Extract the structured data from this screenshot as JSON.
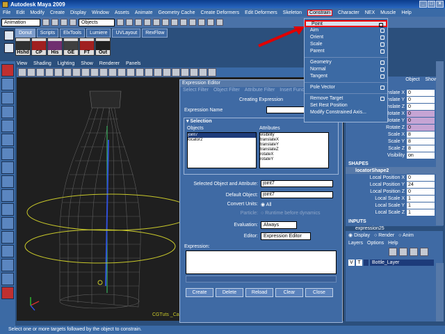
{
  "window": {
    "title": "Autodesk Maya 2009",
    "controls": [
      "_",
      "□",
      "×"
    ]
  },
  "menubar": [
    "File",
    "Edit",
    "Modify",
    "Create",
    "Display",
    "Window",
    "Assets",
    "Animate",
    "Geometry Cache",
    "Create Deformers",
    "Edit Deformers",
    "Skeleton",
    "Constrain",
    "Character",
    "NEX",
    "Muscle",
    "Help"
  ],
  "active_menu": "Constrain",
  "statusline": {
    "mode": "Animation",
    "selection_mode": "Objects"
  },
  "shelf": {
    "tabs": [
      "Donut",
      "Scripts",
      "ElxTools",
      "Lumiere",
      "UVLayout",
      "RexFlow"
    ],
    "buttons": [
      "Hshd",
      "CP",
      "His",
      "GE",
      "FT",
      "Out"
    ]
  },
  "viewport": {
    "menu": [
      "View",
      "Shading",
      "Lighting",
      "Show",
      "Renderer",
      "Panels"
    ],
    "camera_label": "CGTuts _Camera"
  },
  "constrain_menu": {
    "group1": [
      "Point",
      "Aim",
      "Orient",
      "Scale",
      "Parent"
    ],
    "group2": [
      "Geometry",
      "Normal",
      "Tangent"
    ],
    "group3": [
      "Pole Vector"
    ],
    "group4": [
      "Remove Target",
      "Set Rest Position",
      "Modify Constrained Axis..."
    ],
    "highlighted": "Point"
  },
  "expression_editor": {
    "title": "Expression Editor",
    "menu": [
      "Select Filter",
      "Object Filter",
      "Attribute Filter",
      "Insert Func"
    ],
    "heading": "Creating Expression",
    "name_label": "Expression Name",
    "name_value": "",
    "selection_section": "Selection",
    "objects_header": "Objects",
    "attributes_header": "Attributes",
    "objects": [
      "joint7",
      "locator2"
    ],
    "attributes": [
      "visibility",
      "translateX",
      "translateY",
      "translateZ",
      "rotateX",
      "rotateY"
    ],
    "selected_label": "Selected Object and Attribute:",
    "selected_value": "joint7",
    "default_label": "Default Object:",
    "default_value": "joint7",
    "convert_label": "Convert Units:",
    "convert_option": "All",
    "particle_label": "Particle:",
    "particle_option": "Runtime before dynamics",
    "evaluation_label": "Evaluation:",
    "evaluation_value": "Always",
    "editor_label": "Editor:",
    "editor_value": "Expression Editor",
    "expression_label": "Expression:",
    "buttons": [
      "Create",
      "Delete",
      "Reload",
      "Clear",
      "Close"
    ]
  },
  "channel_box": {
    "tabs": [
      "Object",
      "Show"
    ],
    "attrs": [
      {
        "name": "Translate X",
        "value": "0",
        "keyed": false
      },
      {
        "name": "Translate Y",
        "value": "0",
        "keyed": false
      },
      {
        "name": "Translate Z",
        "value": "0",
        "keyed": false
      },
      {
        "name": "Rotate X",
        "value": "0",
        "keyed": true
      },
      {
        "name": "Rotate Y",
        "value": "0",
        "keyed": true
      },
      {
        "name": "Rotate Z",
        "value": "0",
        "keyed": true
      },
      {
        "name": "Scale X",
        "value": "8",
        "keyed": false
      },
      {
        "name": "Scale Y",
        "value": "8",
        "keyed": false
      },
      {
        "name": "Scale Z",
        "value": "8",
        "keyed": false
      },
      {
        "name": "Visibility",
        "value": "on",
        "keyed": false
      }
    ],
    "shapes_label": "SHAPES",
    "shape_name": "locatorShape2",
    "shape_attrs": [
      {
        "name": "Local Position X",
        "value": "0"
      },
      {
        "name": "Local Position Y",
        "value": "24"
      },
      {
        "name": "Local Position Z",
        "value": "0"
      },
      {
        "name": "Local Scale X",
        "value": "1"
      },
      {
        "name": "Local Scale Y",
        "value": "1"
      },
      {
        "name": "Local Scale Z",
        "value": "1"
      }
    ],
    "inputs_label": "INPUTS",
    "input_name": "expression25"
  },
  "layer_editor": {
    "modes": [
      "Display",
      "Render",
      "Anim"
    ],
    "menu": [
      "Layers",
      "Options",
      "Help"
    ],
    "layer": {
      "v": "V",
      "t": "T",
      "name": "Bottle_Layer"
    }
  },
  "helpline": "Select one or more targets followed by the object to constrain."
}
